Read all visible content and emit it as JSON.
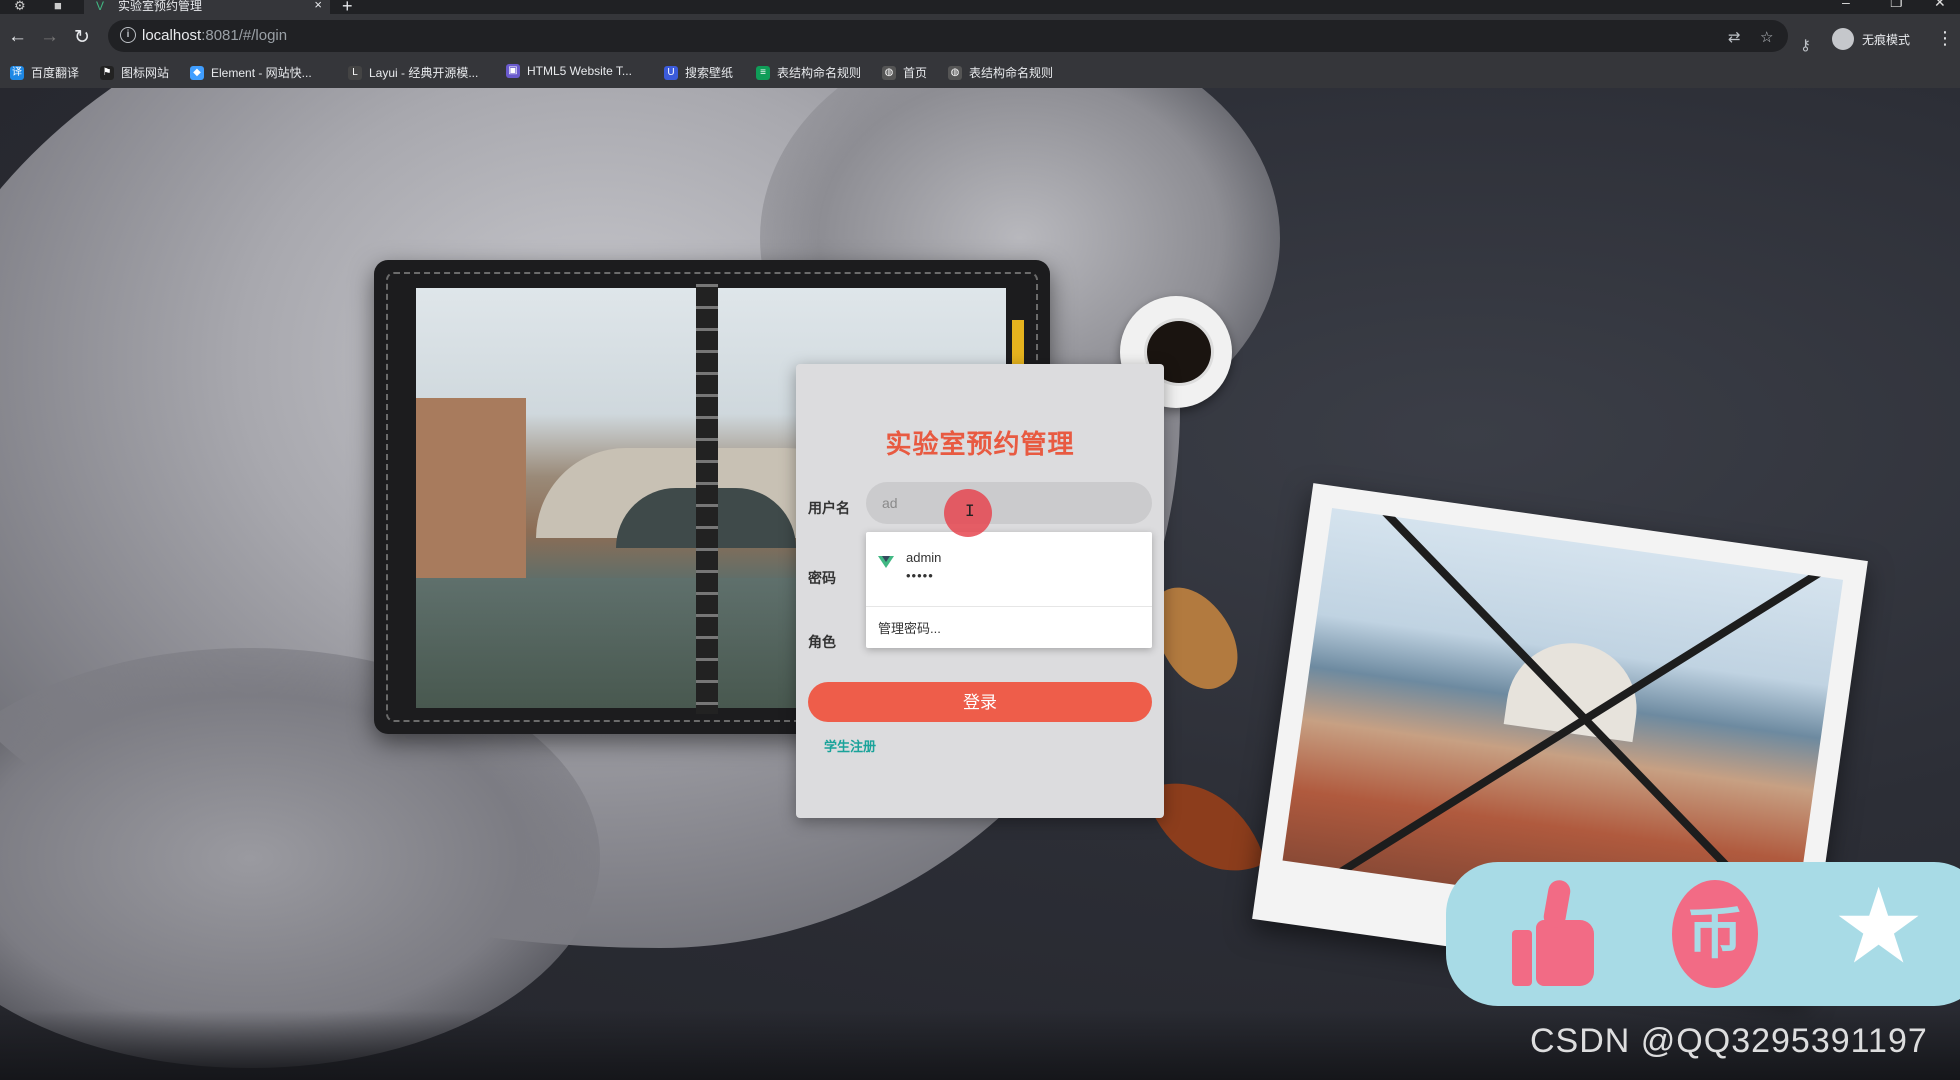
{
  "browser": {
    "tab_title": "实验室预约管理",
    "tab_close": "×",
    "new_tab": "+",
    "url_host": "localhost",
    "url_rest": ":8081/#/login",
    "incognito_label": "无痕模式",
    "bookmarks": [
      {
        "label": "百度翻译",
        "icon_color": "#1e88e5",
        "icon": "译"
      },
      {
        "label": "图标网站",
        "icon_color": "#222222",
        "icon": "⚑"
      },
      {
        "label": "Element - 网站快...",
        "icon_color": "#409eff",
        "icon": "◆"
      },
      {
        "label": "Layui - 经典开源模...",
        "icon_color": "#444444",
        "icon": "L"
      },
      {
        "label": "HTML5 Website T...",
        "icon_color": "#6a5acd",
        "icon": "▣"
      },
      {
        "label": "搜索壁纸",
        "icon_color": "#3b5bdb",
        "icon": "U"
      },
      {
        "label": "表结构命名规则",
        "icon_color": "#0f9d58",
        "icon": "≡"
      },
      {
        "label": "首页",
        "icon_color": "#555555",
        "icon": "◍"
      },
      {
        "label": "表结构命名规则",
        "icon_color": "#555555",
        "icon": "◍"
      }
    ]
  },
  "login": {
    "title": "实验室预约管理",
    "username_label": "用户名",
    "username_value": "ad",
    "password_label": "密码",
    "role_label": "角色",
    "login_button": "登录",
    "register_link": "学生注册"
  },
  "autofill": {
    "suggestion_user": "admin",
    "suggestion_pass": "•••••",
    "manage": "管理密码..."
  },
  "watermark": "CSDN @QQ3295391197"
}
